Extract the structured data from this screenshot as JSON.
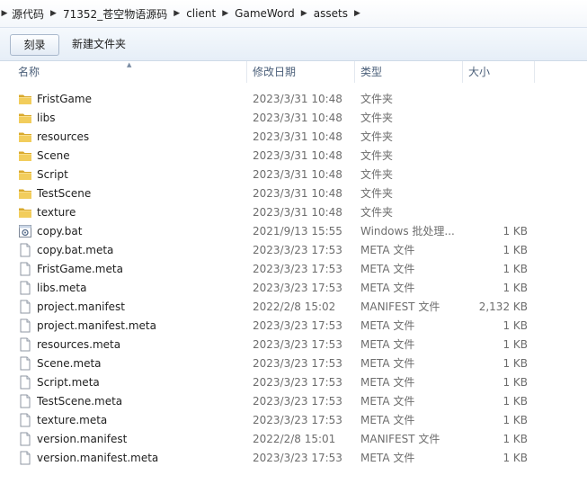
{
  "breadcrumb": [
    "源代码",
    "71352_苍空物语源码",
    "client",
    "GameWord",
    "assets"
  ],
  "toolbar": {
    "burn_label": "刻录",
    "new_folder_label": "新建文件夹"
  },
  "columns": {
    "name": "名称",
    "date": "修改日期",
    "type": "类型",
    "size": "大小"
  },
  "files": [
    {
      "name": "FristGame",
      "date": "2023/3/31 10:48",
      "type": "文件夹",
      "size": "",
      "icon": "folder-icon"
    },
    {
      "name": "libs",
      "date": "2023/3/31 10:48",
      "type": "文件夹",
      "size": "",
      "icon": "folder-icon"
    },
    {
      "name": "resources",
      "date": "2023/3/31 10:48",
      "type": "文件夹",
      "size": "",
      "icon": "folder-icon"
    },
    {
      "name": "Scene",
      "date": "2023/3/31 10:48",
      "type": "文件夹",
      "size": "",
      "icon": "folder-icon"
    },
    {
      "name": "Script",
      "date": "2023/3/31 10:48",
      "type": "文件夹",
      "size": "",
      "icon": "folder-icon"
    },
    {
      "name": "TestScene",
      "date": "2023/3/31 10:48",
      "type": "文件夹",
      "size": "",
      "icon": "folder-icon"
    },
    {
      "name": "texture",
      "date": "2023/3/31 10:48",
      "type": "文件夹",
      "size": "",
      "icon": "folder-icon"
    },
    {
      "name": "copy.bat",
      "date": "2021/9/13 15:55",
      "type": "Windows 批处理...",
      "size": "1 KB",
      "icon": "batch-file-icon"
    },
    {
      "name": "copy.bat.meta",
      "date": "2023/3/23 17:53",
      "type": "META 文件",
      "size": "1 KB",
      "icon": "file-icon"
    },
    {
      "name": "FristGame.meta",
      "date": "2023/3/23 17:53",
      "type": "META 文件",
      "size": "1 KB",
      "icon": "file-icon"
    },
    {
      "name": "libs.meta",
      "date": "2023/3/23 17:53",
      "type": "META 文件",
      "size": "1 KB",
      "icon": "file-icon"
    },
    {
      "name": "project.manifest",
      "date": "2022/2/8 15:02",
      "type": "MANIFEST 文件",
      "size": "2,132 KB",
      "icon": "file-icon"
    },
    {
      "name": "project.manifest.meta",
      "date": "2023/3/23 17:53",
      "type": "META 文件",
      "size": "1 KB",
      "icon": "file-icon"
    },
    {
      "name": "resources.meta",
      "date": "2023/3/23 17:53",
      "type": "META 文件",
      "size": "1 KB",
      "icon": "file-icon"
    },
    {
      "name": "Scene.meta",
      "date": "2023/3/23 17:53",
      "type": "META 文件",
      "size": "1 KB",
      "icon": "file-icon"
    },
    {
      "name": "Script.meta",
      "date": "2023/3/23 17:53",
      "type": "META 文件",
      "size": "1 KB",
      "icon": "file-icon"
    },
    {
      "name": "TestScene.meta",
      "date": "2023/3/23 17:53",
      "type": "META 文件",
      "size": "1 KB",
      "icon": "file-icon"
    },
    {
      "name": "texture.meta",
      "date": "2023/3/23 17:53",
      "type": "META 文件",
      "size": "1 KB",
      "icon": "file-icon"
    },
    {
      "name": "version.manifest",
      "date": "2022/2/8 15:01",
      "type": "MANIFEST 文件",
      "size": "1 KB",
      "icon": "file-icon"
    },
    {
      "name": "version.manifest.meta",
      "date": "2023/3/23 17:53",
      "type": "META 文件",
      "size": "1 KB",
      "icon": "file-icon"
    }
  ],
  "colors": {
    "folder": "#e8c04a",
    "header_text": "#4c607a",
    "detail_text": "#6d6d6d"
  }
}
